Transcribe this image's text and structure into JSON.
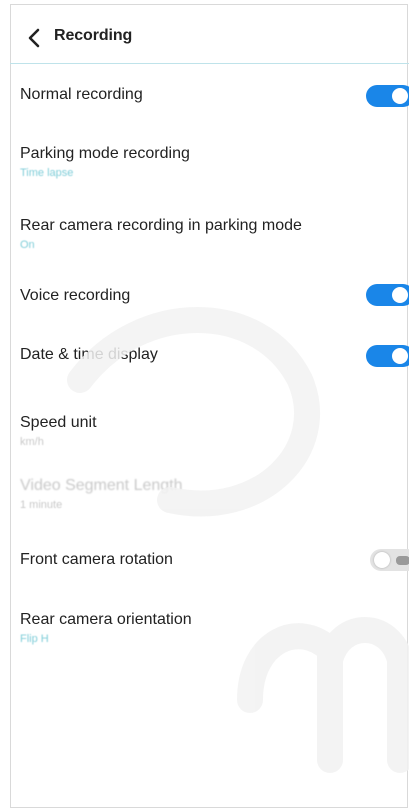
{
  "header": {
    "title": "Recording"
  },
  "settings": [
    {
      "label": "Normal recording",
      "sub": "",
      "toggle": "on"
    },
    {
      "label": "Parking mode recording",
      "sub": "Time lapse",
      "toggle": ""
    },
    {
      "label": "Rear camera recording in parking mode",
      "sub": "On",
      "toggle": ""
    },
    {
      "label": "Voice recording",
      "sub": "",
      "toggle": "on"
    },
    {
      "label": "Date & time display",
      "sub": "",
      "toggle": "on"
    },
    {
      "label": "Speed unit",
      "sub": "km/h",
      "toggle": ""
    },
    {
      "label": "Video Segment Length",
      "sub": "1 minute",
      "toggle": ""
    },
    {
      "label": "Front camera rotation",
      "sub": "",
      "toggle": "off"
    },
    {
      "label": "Rear camera orientation",
      "sub": "Flip H",
      "toggle": ""
    }
  ],
  "colors": {
    "accent": "#1a86e8",
    "subtitle": "#7fcdd8",
    "divider": "#bfe3ea"
  }
}
